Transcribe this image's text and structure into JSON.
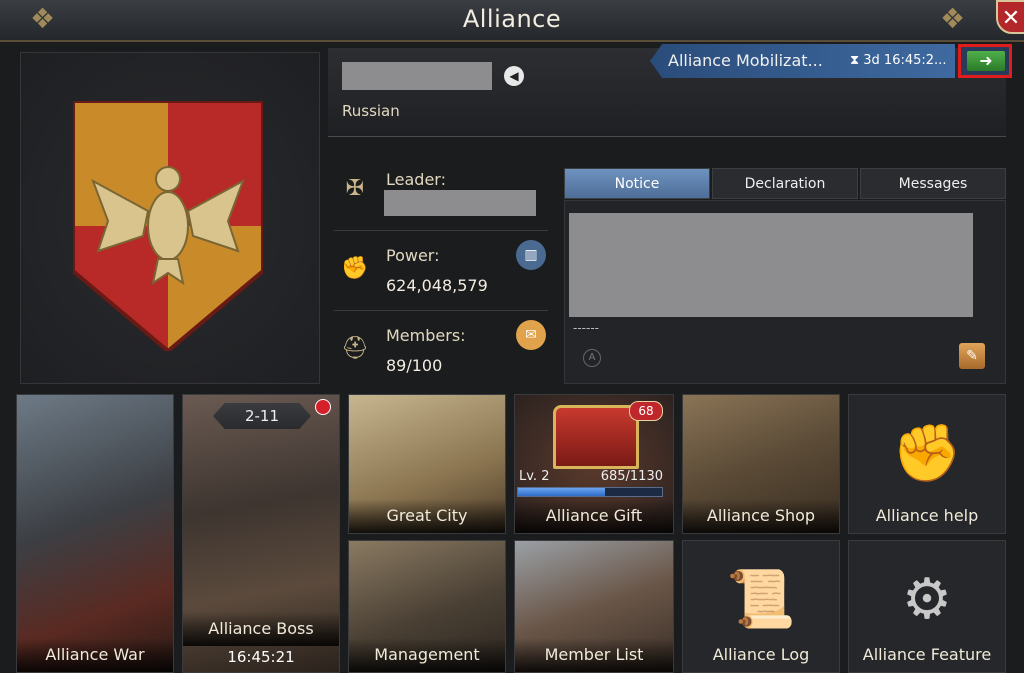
{
  "header": {
    "title": "Alliance",
    "close_icon": "close-icon"
  },
  "alliance": {
    "language": "Russian",
    "mobilization": {
      "title": "Alliance Mobilizat...",
      "timer": "3d 16:45:2..."
    }
  },
  "stats": {
    "leader_label": "Leader:",
    "power_label": "Power:",
    "power_value": "624,048,579",
    "members_label": "Members:",
    "members_value": "89/100"
  },
  "tabs": [
    {
      "label": "Notice",
      "active": true
    },
    {
      "label": "Declaration",
      "active": false
    },
    {
      "label": "Messages",
      "active": false
    }
  ],
  "notice": {
    "dashes": "------"
  },
  "tiles": {
    "war": "Alliance War",
    "boss": {
      "label": "Alliance Boss",
      "level": "2-11",
      "timer": "16:45:21"
    },
    "great_city": "Great City",
    "gift": {
      "label": "Alliance Gift",
      "badge": "68",
      "level": "Lv. 2",
      "progress": "685/1130",
      "progress_fraction": 0.606
    },
    "shop": "Alliance Shop",
    "help": "Alliance help",
    "management": "Management",
    "member_list": "Member List",
    "log": "Alliance Log",
    "feature": "Alliance Feature"
  },
  "colors": {
    "accent_blue": "#4d6e98",
    "highlight_red": "#e01c1c",
    "gift_bar": "#2f6cc8"
  }
}
